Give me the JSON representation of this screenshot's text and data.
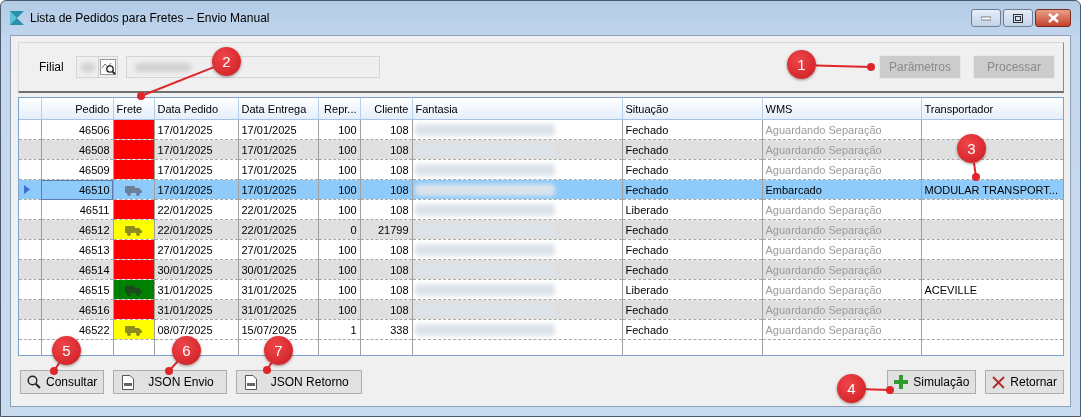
{
  "window": {
    "title": "Lista de Pedidos para Fretes – Envio Manual"
  },
  "filial": {
    "label": "Filial"
  },
  "top_buttons": [
    {
      "label": "Parâmetros",
      "disabled": true
    },
    {
      "label": "Processar",
      "disabled": true
    }
  ],
  "table": {
    "columns": [
      "Pedido",
      "Frete",
      "Data Pedido",
      "Data Entrega",
      "Repr...",
      "Cliente",
      "Fantasia",
      "Situação",
      "WMS",
      "Transportador"
    ],
    "rows": [
      {
        "selected": false,
        "pedido": "46506",
        "color": "#ff0000",
        "truck": false,
        "data_pedido": "17/01/2025",
        "data_entrega": "17/01/2025",
        "repr": "100",
        "cliente": "108",
        "situacao": "Fechado",
        "wms": "Aguardando Separação",
        "wms_muted": true
      },
      {
        "selected": false,
        "pedido": "46508",
        "color": "#ff0000",
        "truck": false,
        "data_pedido": "17/01/2025",
        "data_entrega": "17/01/2025",
        "repr": "100",
        "cliente": "108",
        "situacao": "Fechado",
        "wms": "Aguardando Separação",
        "wms_muted": true
      },
      {
        "selected": false,
        "pedido": "46509",
        "color": "#ff0000",
        "truck": false,
        "data_pedido": "17/01/2025",
        "data_entrega": "17/01/2025",
        "repr": "100",
        "cliente": "108",
        "situacao": "Fechado",
        "wms": "Aguardando Separação",
        "wms_muted": true
      },
      {
        "selected": true,
        "pedido": "46510",
        "truck": true,
        "data_pedido": "17/01/2025",
        "data_entrega": "17/01/2025",
        "repr": "100",
        "cliente": "108",
        "situacao": "Fechado",
        "wms": "Embarcado",
        "wms_muted": false,
        "transportador": "MODULAR TRANSPORT..."
      },
      {
        "selected": false,
        "pedido": "46511",
        "color": "#ff0000",
        "truck": false,
        "data_pedido": "22/01/2025",
        "data_entrega": "22/01/2025",
        "repr": "100",
        "cliente": "108",
        "situacao": "Liberado",
        "wms": "Aguardando Separação",
        "wms_muted": true
      },
      {
        "selected": false,
        "pedido": "46512",
        "color": "#ffff00",
        "truck": true,
        "data_pedido": "22/01/2025",
        "data_entrega": "22/01/2025",
        "repr": "0",
        "cliente": "21799",
        "situacao": "Fechado",
        "wms": "Aguardando Separação",
        "wms_muted": true
      },
      {
        "selected": false,
        "pedido": "46513",
        "color": "#ff0000",
        "truck": false,
        "data_pedido": "27/01/2025",
        "data_entrega": "27/01/2025",
        "repr": "100",
        "cliente": "108",
        "situacao": "Fechado",
        "wms": "Aguardando Separação",
        "wms_muted": true
      },
      {
        "selected": false,
        "pedido": "46514",
        "color": "#ff0000",
        "truck": false,
        "data_pedido": "30/01/2025",
        "data_entrega": "30/01/2025",
        "repr": "100",
        "cliente": "108",
        "situacao": "Fechado",
        "wms": "Aguardando Separação",
        "wms_muted": true
      },
      {
        "selected": false,
        "pedido": "46515",
        "color": "#008000",
        "truck": true,
        "data_pedido": "31/01/2025",
        "data_entrega": "31/01/2025",
        "repr": "100",
        "cliente": "108",
        "situacao": "Liberado",
        "wms": "Aguardando Separação",
        "wms_muted": true,
        "transportador": "ACEVILLE"
      },
      {
        "selected": false,
        "pedido": "46516",
        "color": "#ff0000",
        "truck": false,
        "data_pedido": "31/01/2025",
        "data_entrega": "31/01/2025",
        "repr": "100",
        "cliente": "108",
        "situacao": "Fechado",
        "wms": "Aguardando Separação",
        "wms_muted": true
      },
      {
        "selected": false,
        "pedido": "46522",
        "color": "#ffff00",
        "truck": true,
        "data_pedido": "08/07/2025",
        "data_entrega": "15/07/2025",
        "repr": "1",
        "cliente": "338",
        "situacao": "Fechado",
        "wms": "Aguardando Separação",
        "wms_muted": true
      }
    ]
  },
  "bottom_buttons_left": [
    {
      "label": "Consultar"
    },
    {
      "label": "JSON Envio"
    },
    {
      "label": "JSON Retorno"
    }
  ],
  "bottom_buttons_right": [
    {
      "label": "Simulação"
    },
    {
      "label": "Retornar"
    }
  ],
  "callouts": [
    {
      "number": "1"
    },
    {
      "number": "2"
    },
    {
      "number": "3"
    },
    {
      "number": "4"
    },
    {
      "number": "5"
    },
    {
      "number": "6"
    },
    {
      "number": "7"
    }
  ]
}
